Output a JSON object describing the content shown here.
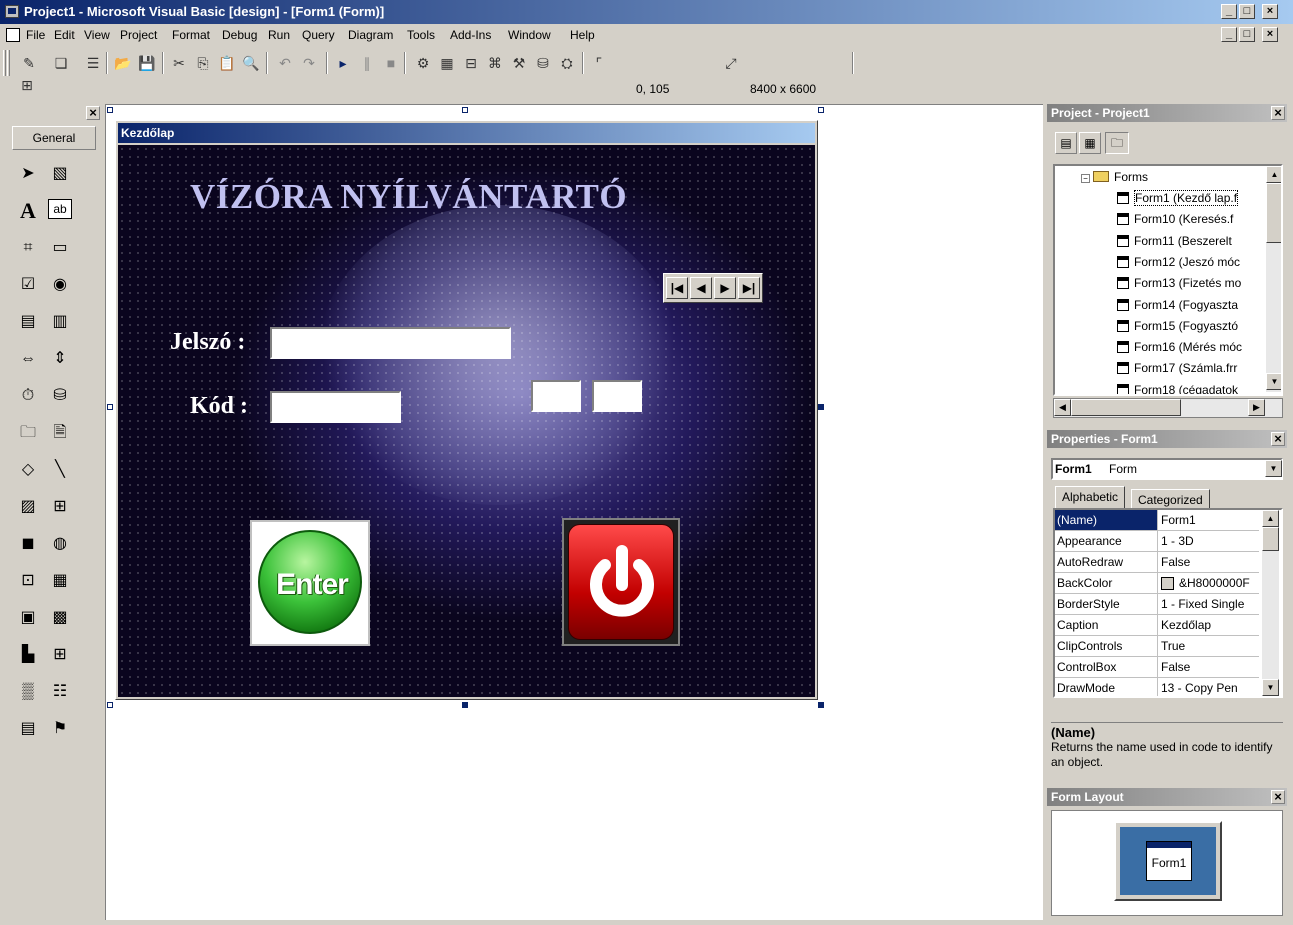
{
  "window": {
    "title": "Project1 - Microsoft Visual Basic [design] - [Form1 (Form)]"
  },
  "menu": [
    "File",
    "Edit",
    "View",
    "Project",
    "Format",
    "Debug",
    "Run",
    "Query",
    "Diagram",
    "Tools",
    "Add-Ins",
    "Window",
    "Help"
  ],
  "toolbar": {
    "position": "0, 105",
    "size": "8400 x 6600"
  },
  "toolbox": {
    "tab": "General",
    "tools": [
      "pointer-icon",
      "picturebox-icon",
      "label-icon",
      "textbox-icon",
      "frame-icon",
      "commandbutton-icon",
      "checkbox-icon",
      "optionbutton-icon",
      "combobox-icon",
      "listbox-icon",
      "hscrollbar-icon",
      "vscrollbar-icon",
      "timer-icon",
      "drivelistbox-icon",
      "dirlistbox-icon",
      "filelistbox-icon",
      "shape-icon",
      "line-icon",
      "image-icon",
      "data-icon",
      "ole-icon",
      "webbrowser-icon",
      "adodc-icon",
      "datagrid-icon",
      "datacombo-icon",
      "datalist-icon",
      "mschart-icon",
      "msflexgrid-icon",
      "dtpicker-icon",
      "monthview-icon",
      "imagelist-icon",
      "treeview-icon"
    ]
  },
  "form": {
    "caption": "Kezdőlap",
    "app_title": "VÍZÓRA NYÍLVÁNTARTÓ",
    "password_label": "Jelszó :",
    "code_label": "Kód :",
    "enter_label": "Enter",
    "nav_buttons": [
      "|◀",
      "◀",
      "▶",
      "▶|"
    ]
  },
  "project_panel": {
    "title": "Project - Project1",
    "folder": "Forms",
    "items": [
      "Form1 (Kezdő lap.f",
      "Form10 (Keresés.f",
      "Form11 (Beszerelt",
      "Form12 (Jeszó móc",
      "Form13 (Fizetés mo",
      "Form14 (Fogyaszta",
      "Form15 (Fogyasztó",
      "Form16 (Mérés móc",
      "Form17 (Számla.frr",
      "Form18 (cégadatok"
    ]
  },
  "properties_panel": {
    "title": "Properties - Form1",
    "object_name": "Form1",
    "object_type": "Form",
    "tabs": [
      "Alphabetic",
      "Categorized"
    ],
    "rows": [
      {
        "name": "(Name)",
        "value": "Form1"
      },
      {
        "name": "Appearance",
        "value": "1 - 3D"
      },
      {
        "name": "AutoRedraw",
        "value": "False"
      },
      {
        "name": "BackColor",
        "value": "&H8000000F"
      },
      {
        "name": "BorderStyle",
        "value": "1 - Fixed Single"
      },
      {
        "name": "Caption",
        "value": "Kezdőlap"
      },
      {
        "name": "ClipControls",
        "value": "True"
      },
      {
        "name": "ControlBox",
        "value": "False"
      },
      {
        "name": "DrawMode",
        "value": "13 - Copy Pen"
      }
    ],
    "desc_title": "(Name)",
    "desc_text": "Returns the name used in code to identify an object."
  },
  "form_layout_panel": {
    "title": "Form Layout",
    "form_label": "Form1"
  }
}
